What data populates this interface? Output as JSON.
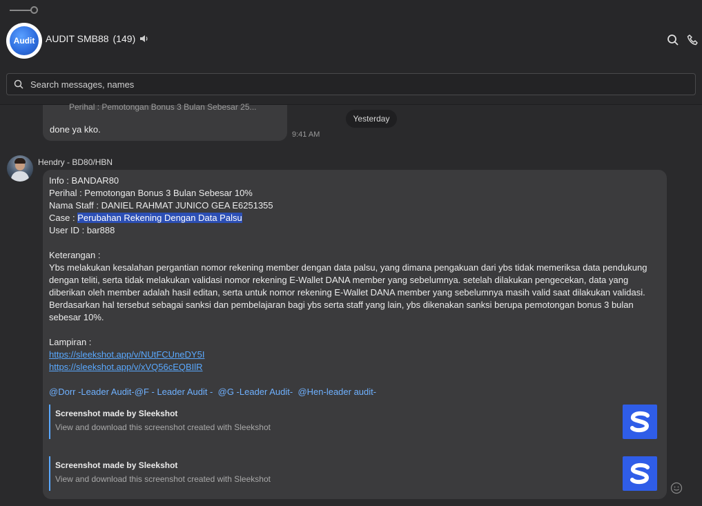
{
  "header": {
    "group_avatar_text": "Audit",
    "title": "AUDIT SMB88",
    "member_count": "(149)",
    "icons": [
      "speaker-icon",
      "search-icon",
      "phone-icon"
    ]
  },
  "search": {
    "placeholder": "Search messages, names"
  },
  "previous_message": {
    "quote": "Perihal : Pemotongan Bonus 3 Bulan Sebesar 25...",
    "text": "done ya kko.",
    "time": "9:41 AM"
  },
  "date_separator": "Yesterday",
  "message": {
    "sender": "Hendry - BD80/HBN",
    "lines": {
      "info": "Info : BANDAR80",
      "perihal": "Perihal : Pemotongan Bonus 3 Bulan Sebesar 10%",
      "nama_staff": "Nama Staff : DANIEL RAHMAT JUNICO GEA E6251355",
      "case_label": "Case : ",
      "case_value": "Perubahan Rekening Dengan Data Palsu",
      "user_id": "User ID : bar888",
      "keterangan_label": "Keterangan :",
      "keterangan_1": "Ybs melakukan kesalahan pergantian nomor rekening member dengan data palsu, yang dimana pengakuan dari ybs tidak memeriksa data pendukung",
      "keterangan_2": "dengan teliti, serta tidak melakukan validasi nomor rekening E-Wallet DANA member yang sebelumnya. setelah dilakukan pengecekan, data yang",
      "keterangan_3": "diberikan oleh member adalah hasil editan, serta untuk nomor rekening E-Wallet DANA member yang sebelumnya masih valid saat dilakukan validasi.",
      "keterangan_4": "Berdasarkan hal tersebut sebagai sanksi dan pembelajaran bagi ybs serta staff yang lain, ybs dikenakan sanksi berupa pemotongan bonus 3 bulan",
      "keterangan_5": "sebesar 10%.",
      "lampiran_label": "Lampiran :",
      "link_1": "https://sleekshot.app/v/NUtFCUneDY5I",
      "link_2": "https://sleekshot.app/v/xVQ56cEQBIlR",
      "mention_1": "@Dorr -Leader Audit-",
      "mention_2": "@F - Leader Audit -",
      "mention_3": "@G -Leader Audit-",
      "mention_4": "@Hen-leader audit-"
    },
    "previews": [
      {
        "title": "Screenshot made by Sleekshot",
        "description": "View and download this screenshot created with Sleekshot",
        "thumb_letter": "S"
      },
      {
        "title": "Screenshot made by Sleekshot",
        "description": "View and download this screenshot created with Sleekshot",
        "thumb_letter": "S"
      }
    ]
  },
  "colors": {
    "background": "#2a2a2c",
    "bubble": "#3b3b3d",
    "link": "#5aa9ff",
    "highlight": "#2c4fb5",
    "thumb": "#2f5de8"
  }
}
